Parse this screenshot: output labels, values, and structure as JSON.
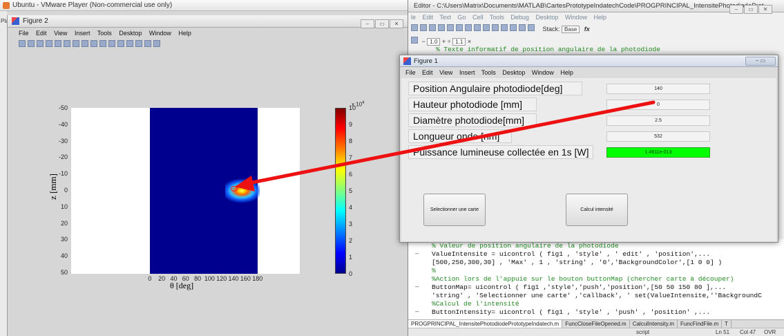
{
  "vmware": {
    "title": "Ubuntu - VMware Player (Non-commercial use only)",
    "side_label": "Pla"
  },
  "figure2": {
    "title": "Figure 2",
    "menu": [
      "File",
      "Edit",
      "View",
      "Insert",
      "Tools",
      "Desktop",
      "Window",
      "Help"
    ],
    "window_controls": [
      "–",
      "▭",
      "✕"
    ],
    "plot": {
      "y_ticks": [
        "-50",
        "-40",
        "-30",
        "-20",
        "-10",
        "0",
        "10",
        "20",
        "30",
        "40",
        "50"
      ],
      "x_ticks": [
        "0",
        "20",
        "40",
        "60",
        "80",
        "100",
        "120",
        "140",
        "160",
        "180"
      ],
      "ylabel": "z [mm]",
      "xlabel": "θ [deg]",
      "colorbar_exponent": "x 10",
      "colorbar_exponent_power": "4",
      "colorbar_ticks": [
        "10",
        "9",
        "8",
        "7",
        "6",
        "5",
        "4",
        "3",
        "2",
        "1",
        "0"
      ],
      "colors": {
        "field": "#00008f",
        "marker": "#ff2222"
      }
    }
  },
  "editor": {
    "title": "Editor - C:\\Users\\Matrix\\Documents\\MATLAB\\CartesPrototypeIndatechCode\\PROGPRINCIPAL_IntensitePhotodiodeProt...",
    "menu": [
      "le",
      "Edit",
      "Text",
      "Go",
      "Cell",
      "Tools",
      "Debug",
      "Desktop",
      "Window",
      "Help"
    ],
    "stack_label": "Stack:",
    "stack_value": "Base",
    "fx": "fx",
    "cell_minus": "−",
    "cell_value1": "1.0",
    "cell_plus": "+",
    "cell_divide": "÷",
    "cell_value2": "1.1",
    "cell_times": "×",
    "code_top": "% Texte informatif de position angulaire de la photodiode",
    "code_lines": [
      {
        "text": "% Valeur de position angulaire de la photodiode",
        "kind": "cmt",
        "dash": ""
      },
      {
        "text": "ValueIntensite = uicontrol ( fig1 , 'style' , ' edit' , 'position',...",
        "kind": "code",
        "dash": "—"
      },
      {
        "text": "[500,250,300,30] , 'Max' , 1 , 'string' , '0','BackgroundColor',[1 0 0] )",
        "kind": "code",
        "dash": ""
      },
      {
        "text": "%",
        "kind": "cmt",
        "dash": ""
      },
      {
        "text": "%Action lors de l'appuie sur le bouton buttonMap (chercher carte à découper)",
        "kind": "cmt",
        "dash": ""
      },
      {
        "text": "ButtonMap= uicontrol ( fig1 ,'style','push','position',[50 50 150 80 ],...",
        "kind": "code",
        "dash": "—"
      },
      {
        "text": "'string' , 'Selectionner une carte' ,'callback', ' set(ValueIntensite,''BackgroundC",
        "kind": "code",
        "dash": ""
      },
      {
        "text": "%Calcul de l'intensité",
        "kind": "cmt",
        "dash": ""
      },
      {
        "text": "ButtonIntensity= uicontrol ( fig1 , 'style' , 'push' , 'position' ,...",
        "kind": "code",
        "dash": "—"
      }
    ],
    "tabs": [
      "PROGPRINCIPAL_IntensitePhotodiodePrototypeIndatech.m",
      "FuncCloseFileOpened.m",
      "CalculIntensity.m",
      "FuncFindFile.m",
      "T"
    ],
    "status": {
      "mode": "script",
      "ln": "Ln 51",
      "col": "Col 47",
      "ovr": "OVR"
    }
  },
  "figure1": {
    "title": "Figure 1",
    "menu": [
      "File",
      "Edit",
      "View",
      "Insert",
      "Tools",
      "Desktop",
      "Window",
      "Help"
    ],
    "rows": [
      {
        "label": "Position Angulaire photodiode[deg]",
        "value": "140"
      },
      {
        "label": "Hauteur photodiode [mm]",
        "value": "0"
      },
      {
        "label": "Diamètre photodiode[mm]",
        "value": "2.5"
      },
      {
        "label": "Longueur onde [nm]",
        "value": "532"
      },
      {
        "label": "Puissance lumineuse collectée en 1s [W]",
        "value": "1.4611e-013"
      }
    ],
    "buttons": {
      "select_map": "Selectionner une carte",
      "compute": "Calcul intensité"
    },
    "colors": {
      "result_bg": "#00ff00"
    }
  },
  "annotation": {
    "arrow_color": "#ee1111"
  }
}
